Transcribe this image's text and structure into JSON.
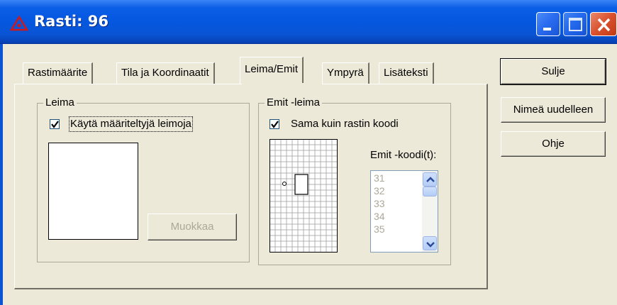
{
  "window": {
    "title": "Rasti: 96",
    "icons": {
      "app": "control-flag-icon",
      "minimize": "minimize-icon",
      "maximize": "maximize-icon",
      "close": "close-icon"
    }
  },
  "tabs": [
    {
      "label": "Rastimääritе",
      "active": false
    },
    {
      "label": "Tila ja Koordinaatit",
      "active": false
    },
    {
      "label": "Leima/Emit",
      "active": true
    },
    {
      "label": "Ympyrä",
      "active": false
    },
    {
      "label": "Lisäteksti",
      "active": false
    }
  ],
  "leima": {
    "group_label": "Leima",
    "checkbox_label": "Käytä määriteltyjä leimoja",
    "checked": true,
    "edit_button": "Muokkaa",
    "edit_enabled": false
  },
  "emit": {
    "group_label": "Emit -leima",
    "checkbox_label": "Sama kuin rastin koodi",
    "checked": true,
    "codes_label": "Emit -koodi(t):",
    "codes": [
      "31",
      "32",
      "33",
      "34",
      "35"
    ]
  },
  "buttons": {
    "close": "Sulje",
    "rename": "Nimeä uudelleen",
    "help": "Ohje"
  }
}
